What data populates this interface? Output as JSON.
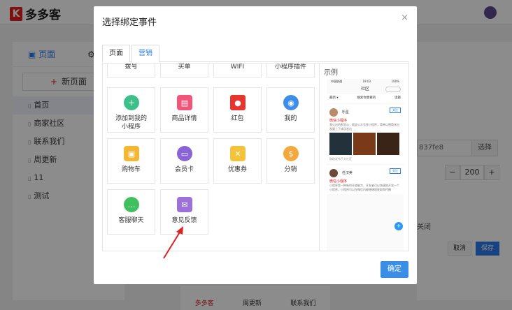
{
  "app": {
    "logo_text": "多多客",
    "logo_mark": "K"
  },
  "left_panel": {
    "tabs": [
      "页面",
      ""
    ],
    "new_page_label": "新页面",
    "items": [
      {
        "label": "首页"
      },
      {
        "label": "商家社区"
      },
      {
        "label": "联系我们"
      },
      {
        "label": "周更新"
      },
      {
        "label": "11"
      },
      {
        "label": "测试"
      }
    ]
  },
  "phone_bottom_nav": [
    "多多客",
    "周更新",
    "联系我们"
  ],
  "right_panel": {
    "input_value": "837fe8",
    "select_label": "选择",
    "stepper_value": "200",
    "stepper_minus": "−",
    "stepper_plus": "+",
    "off_label": "关闭",
    "cancel_label": "取消",
    "save_label": "保存"
  },
  "modal": {
    "title": "选择绑定事件",
    "close_icon": "×",
    "tabs": [
      {
        "label": "页面",
        "active": false
      },
      {
        "label": "营销",
        "active": true
      }
    ],
    "top_row": [
      "拨号",
      "买单",
      "WIFI",
      "小程序插件"
    ],
    "events": [
      {
        "label": "添加到我的\n小程序",
        "icon": "add-to-miniprogram-icon",
        "color": "#3cc08a"
      },
      {
        "label": "商品详情",
        "icon": "product-detail-icon",
        "color": "#f0567a"
      },
      {
        "label": "红包",
        "icon": "red-envelope-icon",
        "color": "#e8362f"
      },
      {
        "label": "我的",
        "icon": "user-icon",
        "color": "#3d8ee6"
      },
      {
        "label": "购物车",
        "icon": "cart-icon",
        "color": "#f5b731"
      },
      {
        "label": "会员卡",
        "icon": "member-card-icon",
        "color": "#8a63d8"
      },
      {
        "label": "优惠券",
        "icon": "coupon-icon",
        "color": "#f5c23a"
      },
      {
        "label": "分销",
        "icon": "distribution-icon",
        "color": "#f2a83a"
      },
      {
        "label": "客服聊天",
        "icon": "chat-icon",
        "color": "#3fbf5d"
      },
      {
        "label": "意见反馈",
        "icon": "feedback-icon",
        "color": "#9d72d8"
      }
    ],
    "preview_label": "示例",
    "preview": {
      "status_left": "中国联通",
      "status_time": "19:03",
      "status_right": "100%",
      "nav_title": "社区",
      "sort_label": "最新 ▾",
      "search_placeholder": "搜索你想看的",
      "search_btn": "话题",
      "post1_name": "乐星",
      "post1_follow": "关注",
      "post1_tag": "微信小程序",
      "post1_text": "我认出的那里心，就返公众号多小程序，简单以图简化出发量上了成功发出",
      "post1_meta": "刚刚发布于大社区",
      "post2_name": "任汉美",
      "post2_follow": "关注",
      "post2_tag": "微信小程序",
      "post2_text": "小程序是一种新的开放能力，开发者可以快速地开发一个小程序。小程序可以在微信内被便捷地获取和传播",
      "fab": "+"
    },
    "ok_label": "确定"
  }
}
